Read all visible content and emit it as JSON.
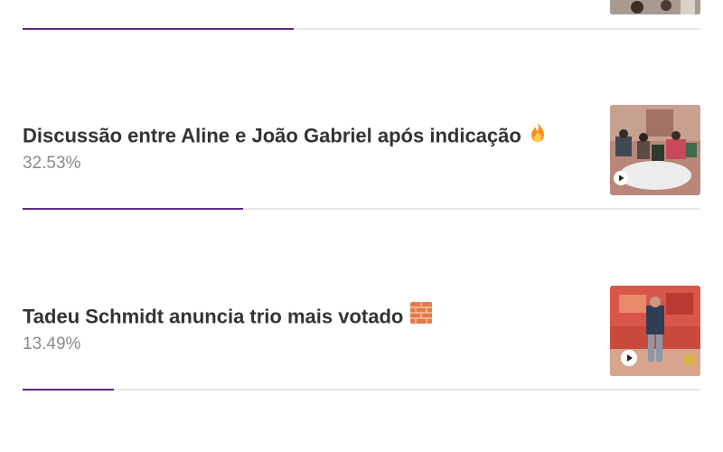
{
  "poll": {
    "options": [
      {
        "title": "",
        "percent_text": "",
        "percent": 0.4,
        "thumbnail": "video-thumbnail-partial"
      },
      {
        "title": "Discussão entre Aline e João Gabriel após indicação",
        "emoji": "fire-icon",
        "percent_text": "32.53%",
        "percent": 0.3253,
        "thumbnail": "video-thumbnail-discussion",
        "play_icon": "play-icon"
      },
      {
        "title": "Tadeu Schmidt anuncia trio mais votado",
        "emoji": "brick-wall-icon",
        "percent_text": "13.49%",
        "percent": 0.1349,
        "thumbnail": "video-thumbnail-announcement",
        "play_icon": "play-icon"
      }
    ],
    "colors": {
      "bar_fill": "#5b2a86",
      "bar_track": "#e8e8e8",
      "title": "#333333",
      "percent": "#8a8a8a"
    }
  }
}
